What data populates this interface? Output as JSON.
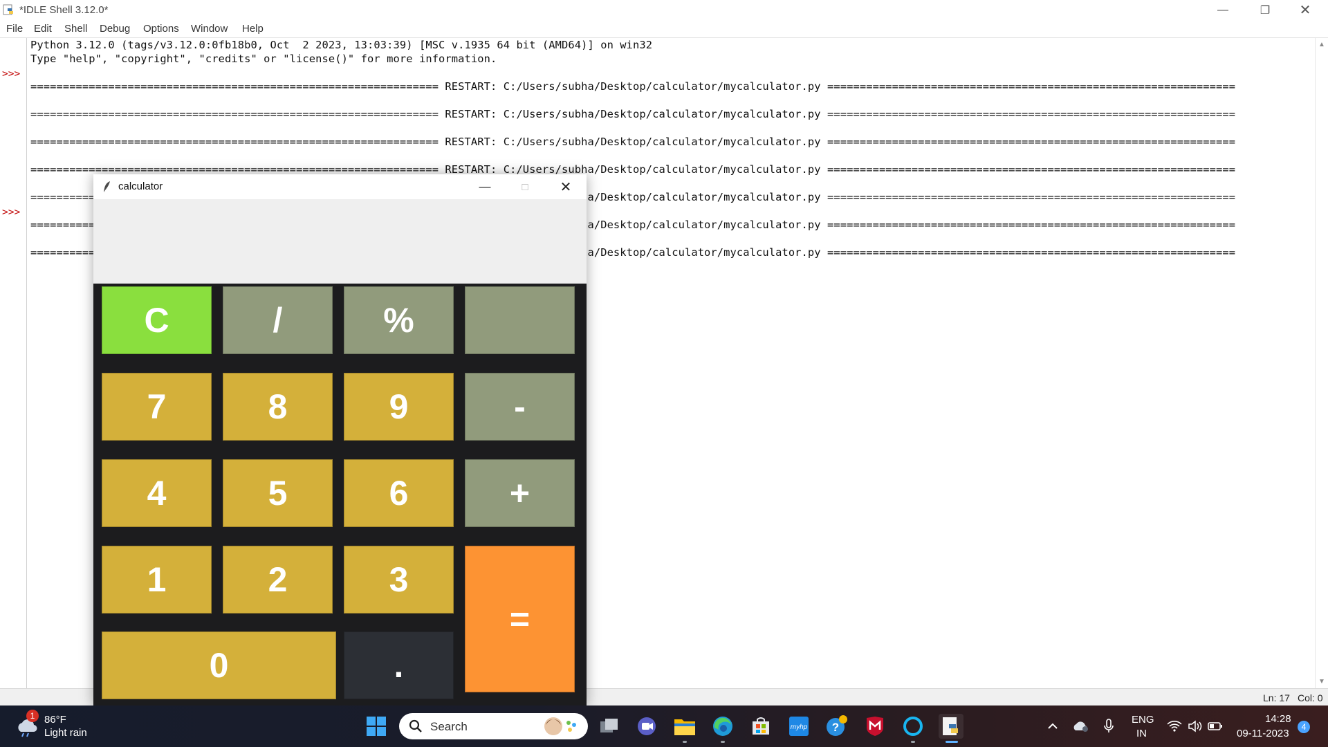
{
  "idle": {
    "title": "*IDLE Shell 3.12.0*",
    "menu": [
      "File",
      "Edit",
      "Shell",
      "Debug",
      "Options",
      "Window",
      "Help"
    ],
    "lines": [
      "Python 3.12.0 (tags/v3.12.0:0fb18b0, Oct  2 2023, 13:03:39) [MSC v.1935 64 bit (AMD64)] on win32",
      "Type \"help\", \"copyright\", \"credits\" or \"license()\" for more information.",
      "=============================================================== RESTART: C:/Users/subha/Desktop/calculator/mycalculator.py ===============================================================",
      "=============================================================== RESTART: C:/Users/subha/Desktop/calculator/mycalculator.py ===============================================================",
      "=============================================================== RESTART: C:/Users/subha/Desktop/calculator/mycalculator.py ===============================================================",
      "=============================================================== RESTART: C:/Users/subha/Desktop/calculator/mycalculator.py ===============================================================",
      "=============================================================== RESTART: C:/Users/subha/Desktop/calculator/mycalculator.py ===============================================================",
      "=============================================================== RESTART: C:/Users/subha/Desktop/calculator/mycalculator.py ===============================================================",
      "=============================================================== RESTART: C:/Users/subha/Desktop/calculator/mycalculator.py ==============================================================="
    ],
    "prompt": ">>>",
    "status_line": "Ln: 17",
    "status_col": "Col: 0"
  },
  "calculator": {
    "title": "calculator",
    "display_value": "",
    "buttons": {
      "clear": "C",
      "divide": "/",
      "percent": "%",
      "blank": "",
      "seven": "7",
      "eight": "8",
      "nine": "9",
      "minus": "-",
      "four": "4",
      "five": "5",
      "six": "6",
      "plus": "+",
      "one": "1",
      "two": "2",
      "three": "3",
      "equals": "=",
      "zero": "0",
      "dot": "."
    },
    "colors": {
      "digit": "#d4b03a",
      "operator": "#919b7c",
      "clear": "#8adf3e",
      "equals": "#fd9333",
      "dot": "#2c2f35"
    }
  },
  "taskbar": {
    "weather_temp": "86°F",
    "weather_desc": "Light rain",
    "weather_badge": "1",
    "search_label": "Search",
    "lang_top": "ENG",
    "lang_bottom": "IN",
    "time": "14:28",
    "date": "09-11-2023",
    "notif_count": "4",
    "apps": [
      "windows-start-icon",
      "task-view-icon",
      "teams-chat-icon",
      "file-explorer-icon",
      "edge-icon",
      "store-icon",
      "myhp-icon",
      "help-icon",
      "mcafee-icon",
      "alexa-icon",
      "idle-python-icon"
    ]
  }
}
